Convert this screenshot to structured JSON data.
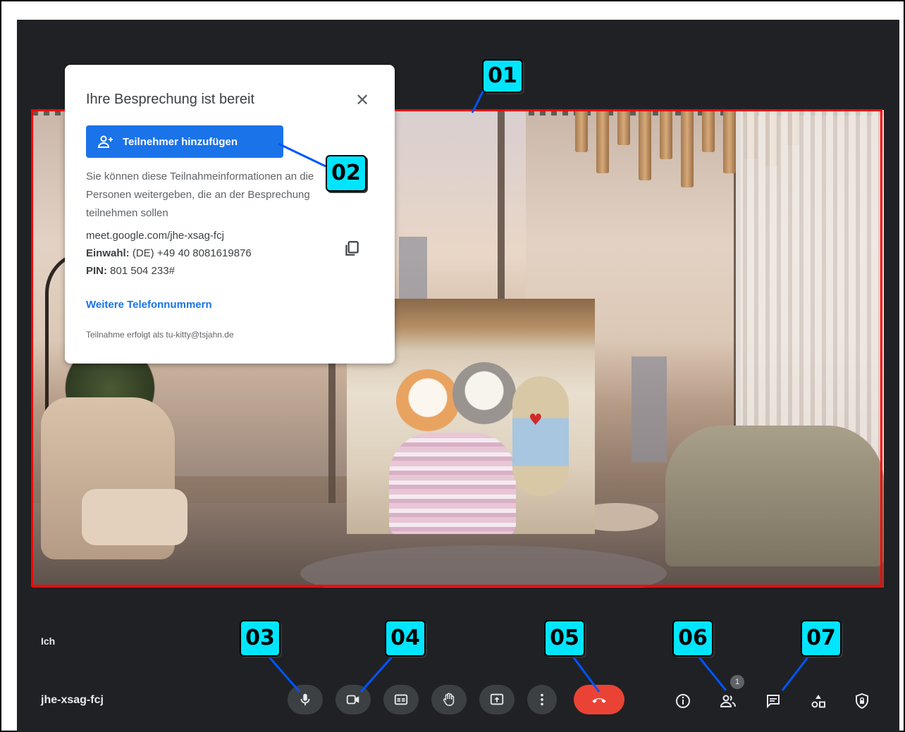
{
  "meeting": {
    "self_label": "Ich",
    "code": "jhe-xsag-fcj",
    "participant_count": "1"
  },
  "dialog": {
    "title": "Ihre Besprechung ist bereit",
    "add_button_label": "Teilnehmer hinzufügen",
    "description": "Sie können diese Teilnahmeinformationen an die Personen weitergeben, die an der Besprechung teilnehmen sollen",
    "meeting_url": "meet.google.com/jhe-xsag-fcj",
    "dialin_label": "Einwahl:",
    "dialin_value": "(DE) +49 40 8081619876",
    "pin_label": "PIN:",
    "pin_value": "801 504 233#",
    "more_numbers_link": "Weitere Telefonnummern",
    "joined_as": "Teilnahme erfolgt als tu-kitty@tsjahn.de"
  },
  "callouts": [
    "01",
    "02",
    "03",
    "04",
    "05",
    "06",
    "07"
  ],
  "controls": {
    "icons": [
      "mic-icon",
      "camera-icon",
      "captions-icon",
      "raise-hand-icon",
      "present-screen-icon",
      "more-options-icon",
      "hang-up-icon"
    ],
    "right_icons": [
      "info-icon",
      "people-icon",
      "chat-icon",
      "activities-icon",
      "host-controls-icon"
    ]
  },
  "colors": {
    "background": "#202124",
    "control": "#3c4043",
    "hangup": "#ea4335",
    "primary": "#1a73e8",
    "callout": "#00e5ff",
    "highlight": "#ff0000"
  }
}
